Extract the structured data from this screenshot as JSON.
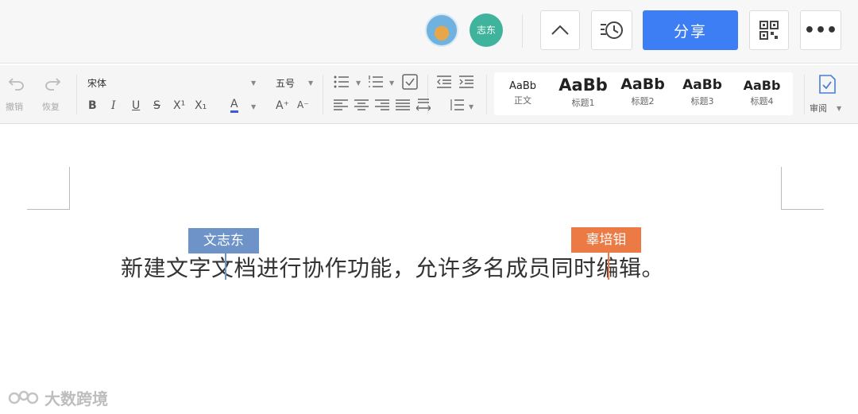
{
  "header": {
    "avatar2_label": "志东",
    "share_label": "分享",
    "more_label": "•••"
  },
  "ribbon": {
    "undo_label": "撤销",
    "redo_label": "恢复",
    "font_family": "宋体",
    "font_size": "五号",
    "bold": "B",
    "italic": "I",
    "underline": "U",
    "strike": "S",
    "superscript": "X¹",
    "subscript": "X₁",
    "font_color": "A",
    "font_color_value": "#3d5bd9",
    "grow_font": "A⁺",
    "shrink_font": "A⁻",
    "styles": [
      {
        "sample": "AaBb",
        "name": "正文"
      },
      {
        "sample": "AaBb",
        "name": "标题1"
      },
      {
        "sample": "AaBb",
        "name": "标题2"
      },
      {
        "sample": "AaBb",
        "name": "标题3"
      },
      {
        "sample": "AaBb",
        "name": "标题4"
      }
    ],
    "review_label": "审阅"
  },
  "document": {
    "text": "新建文字文档进行协作功能，允许多名成员同时编辑。",
    "collaborators": [
      {
        "name": "文志东",
        "color": "#6d93c9"
      },
      {
        "name": "辜培钼",
        "color": "#ec7a45"
      }
    ]
  },
  "watermark": {
    "text": "大数跨境"
  },
  "colors": {
    "share_button": "#3d7ef5",
    "avatar2": "#3fb39c"
  }
}
